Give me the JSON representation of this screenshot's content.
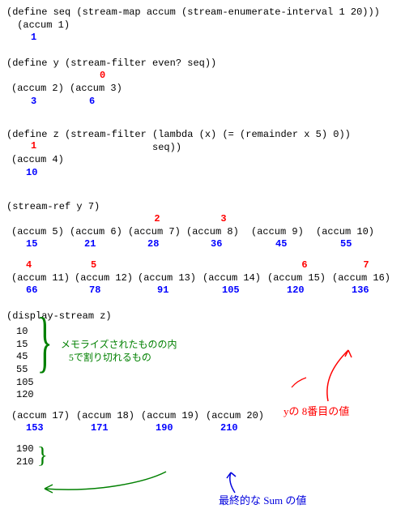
{
  "line1": "(define seq (stream-map accum (stream-enumerate-interval 1 20)))",
  "l2": "(accum 1)",
  "l2v": "1",
  "line3": "(define y (stream-filter even? seq))",
  "red0": "0",
  "a2": "(accum 2)",
  "a3": "(accum 3)",
  "v2": "3",
  "v3": "6",
  "line4a": "(define z (stream-filter (lambda (x) (= (remainder x 5) 0))",
  "line4b": "                         seq))",
  "red1": "1",
  "a4": "(accum 4)",
  "v4": "10",
  "line5": "(stream-ref y 7)",
  "r2": "2",
  "r3": "3",
  "a5": "(accum 5)",
  "a6": "(accum 6)",
  "a7": "(accum 7)",
  "a8": "(accum 8)",
  "a9": "(accum 9)",
  "a10": "(accum 10)",
  "v5": "15",
  "v6": "21",
  "v7": "28",
  "v8": "36",
  "v9": "45",
  "v10": "55",
  "r4": "4",
  "r5": "5",
  "r6": "6",
  "r7": "7",
  "a11": "(accum 11)",
  "a12": "(accum 12)",
  "a13": "(accum 13)",
  "a14": "(accum 14)",
  "a15": "(accum 15)",
  "a16": "(accum 16)",
  "v11": "66",
  "v12": "78",
  "v13": "91",
  "v14": "105",
  "v15": "120",
  "v16": "136",
  "line6": "(display-stream z)",
  "m1": "10",
  "m2": "15",
  "m3": "45",
  "m4": "55",
  "m5": "105",
  "m6": "120",
  "note1a": "メモライズされたものの内",
  "note1b": "5で割り切れるもの",
  "note2": "yの 8番目の値",
  "a17": "(accum 17)",
  "a18": "(accum 18)",
  "a19": "(accum 19)",
  "a20": "(accum 20)",
  "v17": "153",
  "v18": "171",
  "v19": "190",
  "v20": "210",
  "t1": "190",
  "t2": "210",
  "note3": "最終的な Sum の値"
}
